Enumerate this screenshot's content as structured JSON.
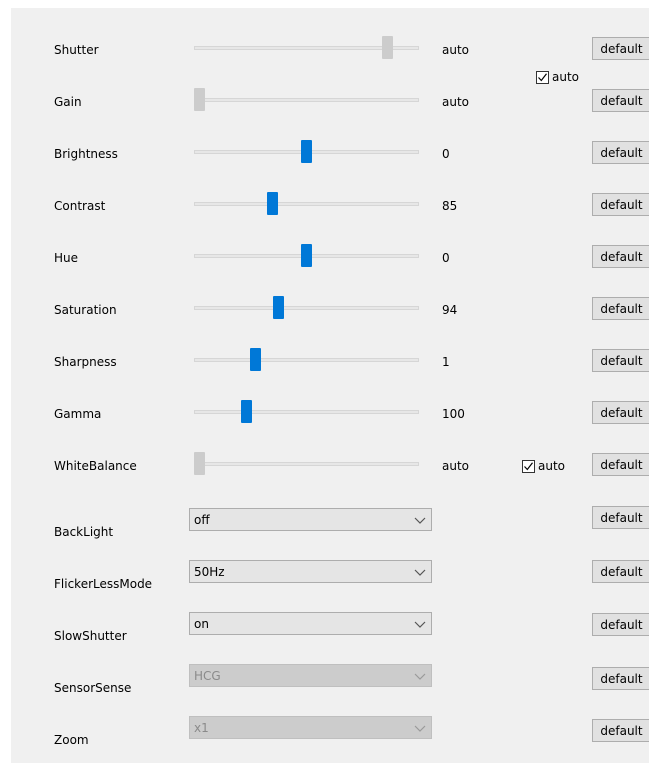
{
  "sliders": [
    {
      "label": "Shutter",
      "value": "auto",
      "level": 0.88,
      "state": "disabled"
    },
    {
      "label": "Gain",
      "value": "auto",
      "level": 0.0,
      "state": "disabled"
    },
    {
      "label": "Brightness",
      "value": "0",
      "level": 0.5,
      "state": "active"
    },
    {
      "label": "Contrast",
      "value": "85",
      "level": 0.34,
      "state": "active"
    },
    {
      "label": "Hue",
      "value": "0",
      "level": 0.5,
      "state": "active"
    },
    {
      "label": "Saturation",
      "value": "94",
      "level": 0.37,
      "state": "active"
    },
    {
      "label": "Sharpness",
      "value": "1",
      "level": 0.26,
      "state": "active"
    },
    {
      "label": "Gamma",
      "value": "100",
      "level": 0.22,
      "state": "active"
    },
    {
      "label": "WhiteBalance",
      "value": "auto",
      "level": 0.0,
      "state": "disabled"
    }
  ],
  "auto_checks": [
    {
      "label": "auto",
      "checked": true
    },
    {
      "label": "auto",
      "checked": true
    }
  ],
  "dropdowns": [
    {
      "label": "BackLight",
      "value": "off",
      "enabled": true
    },
    {
      "label": "FlickerLessMode",
      "value": "50Hz",
      "enabled": true
    },
    {
      "label": "SlowShutter",
      "value": "on",
      "enabled": true
    },
    {
      "label": "SensorSense",
      "value": "HCG",
      "enabled": false
    },
    {
      "label": "Zoom",
      "value": "x1",
      "enabled": false
    }
  ],
  "default_label": "default",
  "colors": {
    "accent": "#0078d7",
    "panel": "#f0f0f0",
    "button": "#e1e1e1"
  }
}
